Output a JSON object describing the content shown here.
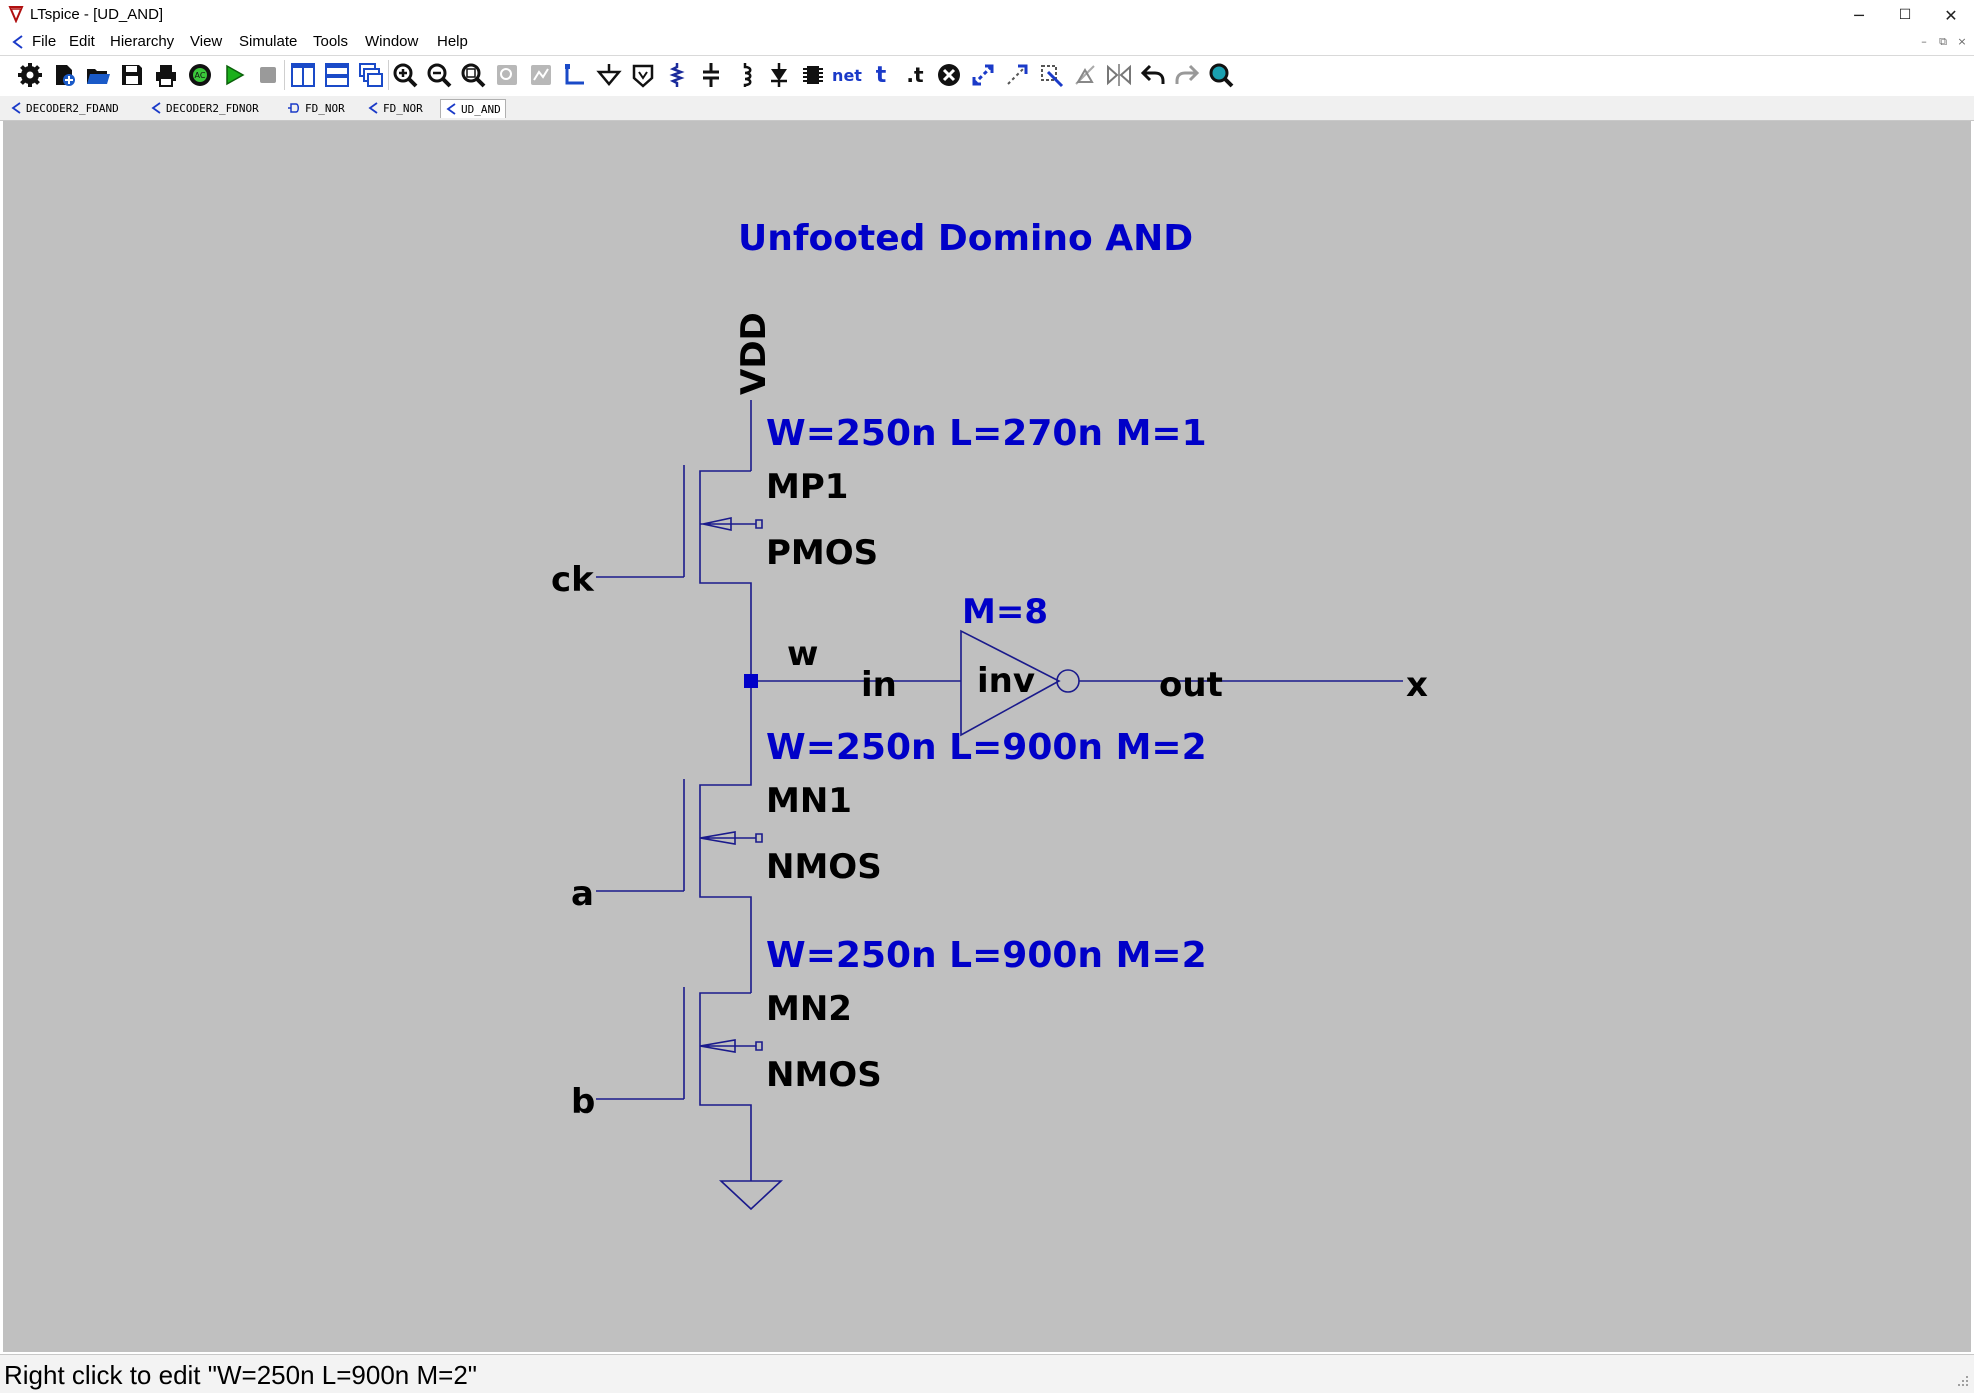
{
  "window": {
    "title": "LTspice - [UD_AND]",
    "controls": {
      "minimize": "─",
      "maximize": "☐",
      "close": "✕"
    }
  },
  "menu": {
    "items": [
      "File",
      "Edit",
      "Hierarchy",
      "View",
      "Simulate",
      "Tools",
      "Window",
      "Help"
    ],
    "mdi_controls": {
      "minimize": "–",
      "restore": "⧉",
      "close": "×"
    }
  },
  "toolbar": {
    "buttons": [
      "settings-icon",
      "new-schematic-icon",
      "open-icon",
      "save-icon",
      "print-icon",
      "ac-analysis-icon",
      "run-icon",
      "halt-icon",
      "tile-vertical-icon",
      "tile-horizontal-icon",
      "cascade-icon",
      "zoom-in-icon",
      "zoom-out-icon",
      "zoom-fit-icon",
      "zoom-back-icon",
      "autorange-icon",
      "wire-icon",
      "ground-icon",
      "label-net-icon",
      "resistor-icon",
      "capacitor-icon",
      "inductor-icon",
      "diode-icon",
      "component-icon",
      "net-label-icon",
      "text-icon",
      "spice-directive-icon",
      "delete-icon",
      "duplicate-icon",
      "move-icon",
      "drag-icon",
      "rotate-icon",
      "mirror-icon",
      "undo-icon",
      "redo-icon",
      "find-icon"
    ],
    "net_label": "net",
    "text_label": "t",
    "directive_label": ".t"
  },
  "tabs": [
    {
      "label": "DECODER2_FDAND",
      "icon": "schematic-icon"
    },
    {
      "label": "DECODER2_FDNOR",
      "icon": "schematic-icon"
    },
    {
      "label": "FD_NOR",
      "icon": "symbol-icon"
    },
    {
      "label": "FD_NOR",
      "icon": "schematic-icon"
    },
    {
      "label": "UD_AND",
      "icon": "schematic-icon",
      "active": true
    }
  ],
  "schematic": {
    "title": "Unfooted Domino AND",
    "supply": "VDD",
    "mp1": {
      "params": "W=250n L=270n M=1",
      "name": "MP1",
      "model": "PMOS"
    },
    "mn1": {
      "params": "W=250n L=900n M=2",
      "name": "MN1",
      "model": "NMOS"
    },
    "mn2": {
      "params": "W=250n L=900n M=2",
      "name": "MN2",
      "model": "NMOS"
    },
    "inv": {
      "params": "M=8",
      "name": "inv",
      "in_pin": "in",
      "out_pin": "out"
    },
    "nets": {
      "ck": "ck",
      "w": "w",
      "a": "a",
      "b": "b",
      "x": "x"
    },
    "colors": {
      "wire": "#1a1a8c",
      "param": "#0000c8",
      "label": "#000000",
      "background": "#c0c0c0"
    }
  },
  "status": {
    "text": "Right click to edit \"W=250n L=900n M=2\""
  }
}
